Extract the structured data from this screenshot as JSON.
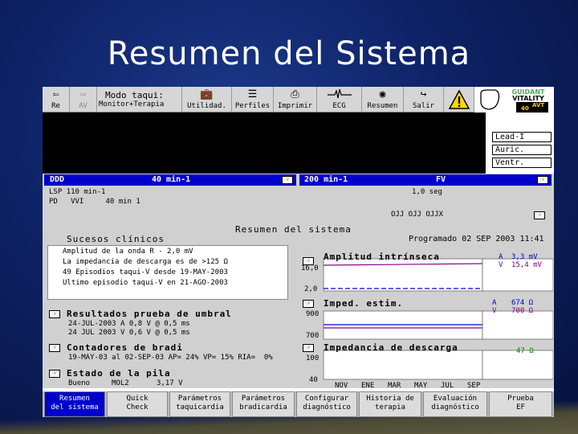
{
  "slide_title": "Resumen del Sistema",
  "toolbar": {
    "items": [
      {
        "label": "Re",
        "icon": "back-arrow-icon"
      },
      {
        "label": "AV",
        "icon": "forward-arrow-icon"
      },
      {
        "label_top": "Modo taqui:",
        "label": "Monitor+Terapia"
      },
      {
        "label": "Utilidad.",
        "icon": "briefcase-icon"
      },
      {
        "label": "Perfiles",
        "icon": "folder-icon"
      },
      {
        "label": "Imprimir",
        "icon": "printer-icon"
      },
      {
        "label": "ECG",
        "icon": "ecg-wave-icon"
      },
      {
        "label": "Resumen",
        "icon": "camera-icon"
      },
      {
        "label": "Salir",
        "icon": "exit-icon"
      }
    ],
    "brand_line1": "GUIDANT",
    "brand_line2": "VITALITY",
    "brand_line3": "AVT",
    "brand_line4": "40"
  },
  "leads": [
    "Lead-I",
    "Auric.",
    "Ventr."
  ],
  "info": {
    "left_header": "DDD",
    "left_rate": "40 min-1",
    "left_line1": "LSP 110 min-1",
    "left_line2": "PD   VVI     40 min 1",
    "right_header": "200 min-1",
    "right_mode": "FV",
    "right_line1": "1,0 seg",
    "right_line2": "OJJ OJJ OJJX"
  },
  "summary": {
    "title": "Resumen del sistema",
    "programmed": "Programado 02 SEP 2003 11:41",
    "clinical_title": "Sucesos clínicos",
    "clinical_events": [
      "Amplitud de la onda R - 2,0 mV",
      "La impedancia de descarga es de >125 Ω",
      "49 Episodios taqui-V desde 19-MAY-2003",
      "Ultimo episodio taqui-V en 21-AGO-2003"
    ],
    "threshold_title": "Resultados prueba de umbral",
    "threshold_rows": [
      "24-JUL-2003 A 0,8 V @ 0,5 ms",
      "24 JUL 2003 V 0,6 V @ 0,5 ms"
    ],
    "brady_title": "Contadores de bradi",
    "brady_row": "19-MAY-03 al 02-SEP-03 AP= 24% VP= 15% RIA=  0%",
    "battery_title": "Estado de la pila",
    "battery_status": "Bueno",
    "battery_type": "MOL2",
    "battery_volts": "3,17 V"
  },
  "charts": {
    "amplitude": {
      "title": "Amplitud intrínseca",
      "y_top": "16,0",
      "y_bottom": "2,0",
      "legend_a": "A",
      "legend_v": "V",
      "value_a": "3,3 mV",
      "value_v": "15,4 mV"
    },
    "impedance": {
      "title": "Imped. estim.",
      "y_top": "900",
      "y_bottom": "700",
      "legend_a": "A",
      "legend_v": "V",
      "value_a": "674 Ω",
      "value_v": "700 Ω"
    },
    "shock": {
      "title": "Impedancia de descarga",
      "y_top": "100",
      "y_bottom": "40",
      "value": "47 Ω"
    },
    "months": [
      "NOV",
      "ENE",
      "MAR",
      "MAY",
      "JUL",
      "SEP"
    ]
  },
  "bottom_buttons": [
    "Resumen\ndel sistema",
    "Quick\nCheck",
    "Parámetros\ntaquicardia",
    "Parámetros\nbradicardia",
    "Configurar\ndiagnóstico",
    "Historia de\nterapia",
    "Evaluación\ndiagnóstico",
    "Prueba\nEF"
  ],
  "colors": {
    "header_blue": "#0000cc",
    "trace_blue": "#0000dd",
    "trace_purple": "#880088",
    "value_blue": "#0000cc"
  }
}
